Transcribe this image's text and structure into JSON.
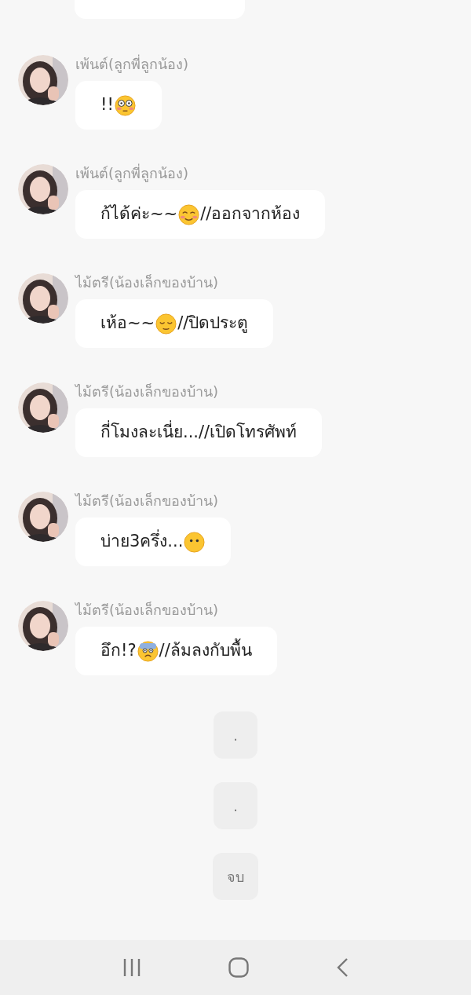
{
  "messages": [
    {
      "sender": "เพ้นต์(ลูกพี่ลูกน้อง)",
      "avatar": {
        "kind": "picture"
      },
      "parts": [
        {
          "kind": "text",
          "text": "!!"
        },
        {
          "kind": "flushed"
        }
      ]
    },
    {
      "sender": "เพ้นต์(ลูกพี่ลูกน้อง)",
      "avatar": {
        "kind": "picture"
      },
      "parts": [
        {
          "kind": "text",
          "text": "ก้ได้ค่ะ~~"
        },
        {
          "kind": "smiling"
        },
        {
          "kind": "text",
          "text": "//ออกจากห้อง"
        }
      ]
    },
    {
      "sender": "ไม้ตรี(น้องเล็กของบ้าน)",
      "avatar": {
        "kind": "picture"
      },
      "parts": [
        {
          "kind": "text",
          "text": "เห้อ~~"
        },
        {
          "kind": "relieved"
        },
        {
          "kind": "text",
          "text": "//ปิดประตู"
        }
      ]
    },
    {
      "sender": "ไม้ตรี(น้องเล็กของบ้าน)",
      "avatar": {
        "kind": "picture"
      },
      "parts": [
        {
          "kind": "text",
          "text": "กี่โมงละเนี่ย...//เปิดโทรศัพท์"
        }
      ]
    },
    {
      "sender": "ไม้ตรี(น้องเล็กของบ้าน)",
      "avatar": {
        "kind": "picture"
      },
      "parts": [
        {
          "kind": "text",
          "text": "บ่าย3ครึ่ง..."
        },
        {
          "kind": "blank"
        }
      ]
    },
    {
      "sender": "ไม้ตรี(น้องเล็กของบ้าน)",
      "avatar": {
        "kind": "picture"
      },
      "parts": [
        {
          "kind": "text",
          "text": "อึก!?"
        },
        {
          "kind": "fearful"
        },
        {
          "kind": "text",
          "text": "//ล้มลงกับพื้น"
        }
      ]
    }
  ],
  "notes": [
    {
      "text": "."
    },
    {
      "text": "."
    },
    {
      "text": "จบ"
    }
  ]
}
